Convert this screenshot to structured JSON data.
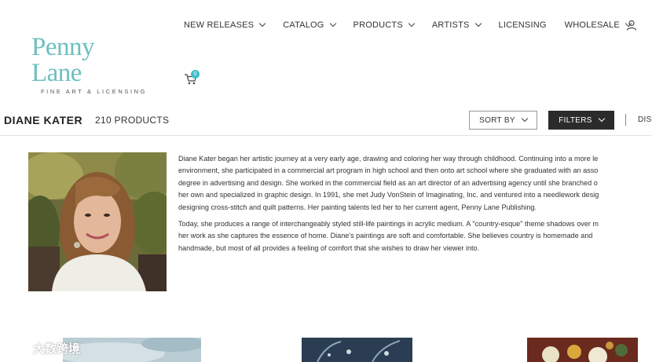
{
  "logo": {
    "main": "Penny Lane",
    "sub": "FINE ART & LICENSING"
  },
  "nav": {
    "items": [
      {
        "label": "NEW RELEASES",
        "dropdown": true
      },
      {
        "label": "CATALOG",
        "dropdown": true
      },
      {
        "label": "PRODUCTS",
        "dropdown": true
      },
      {
        "label": "ARTISTS",
        "dropdown": true
      },
      {
        "label": "LICENSING",
        "dropdown": false
      },
      {
        "label": "WHOLESALE",
        "dropdown": true
      }
    ],
    "user_icon": "user-icon",
    "cart_icon": "cart-icon",
    "cart_count": "0"
  },
  "collection": {
    "artist_name": "DIANE KATER",
    "product_count": "210 PRODUCTS",
    "sort_label": "SORT BY",
    "filters_label": "FILTERS",
    "display_label": "DIS"
  },
  "bio": {
    "paragraphs": [
      "Diane Kater began her artistic journey at a very early age, drawing and coloring her way through childhood. Continuing into a more le\nenvironment, she participated in a commercial art program in high school and then onto art school where she graduated with an asso\ndegree in advertising and design. She worked in the commercial field as an art director of an advertising agency until she branched o\nher own and specialized in graphic design. In 1991, she met Judy VonStein of Imaginating, Inc. and ventured into a needlework desig\ndesigning cross-stitch and quilt patterns. Her painting talents led her to her current agent, Penny Lane Publishing.",
      "Today, she produces a range of interchangeably styled still-life paintings in acrylic medium. A \"country-esque\" theme shadows over m\nher work as she captures the essence of home. Diane's paintings are soft and comfortable. She believes country is homemade and\nhandmade, but most of all provides a feeling of comfort that she wishes to draw her viewer into."
    ]
  },
  "watermark": "大数跨境",
  "colors": {
    "brand_teal": "#6cbfbf",
    "badge": "#3fbfc9",
    "filter_bg": "#2b2b2b"
  }
}
